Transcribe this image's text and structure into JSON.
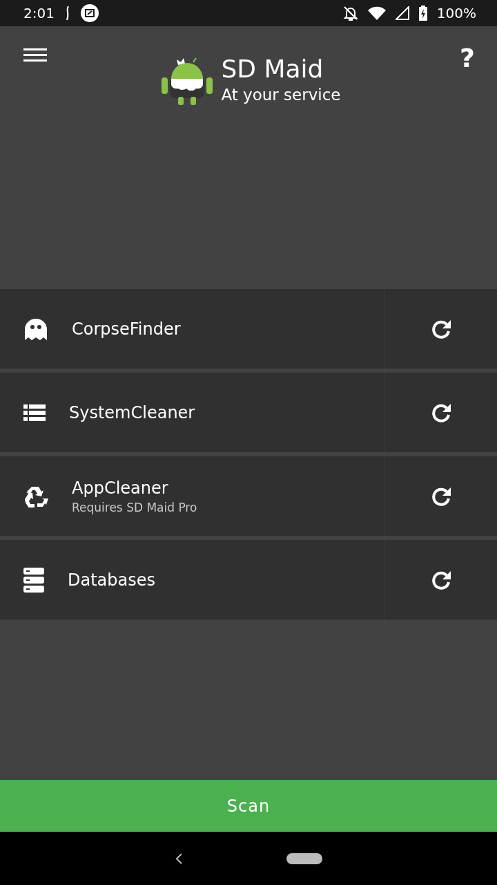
{
  "status_bar": {
    "time": "2:01",
    "battery": "100%"
  },
  "header": {
    "title": "SD Maid",
    "subtitle": "At your service",
    "help": "?"
  },
  "modules": [
    {
      "kind": "ghost",
      "name": "CorpseFinder"
    },
    {
      "kind": "list",
      "name": "SystemCleaner"
    },
    {
      "kind": "recycle",
      "name": "AppCleaner",
      "subtitle": "Requires SD Maid Pro"
    },
    {
      "kind": "database",
      "name": "Databases"
    }
  ],
  "scan_button": {
    "label": "Scan"
  }
}
